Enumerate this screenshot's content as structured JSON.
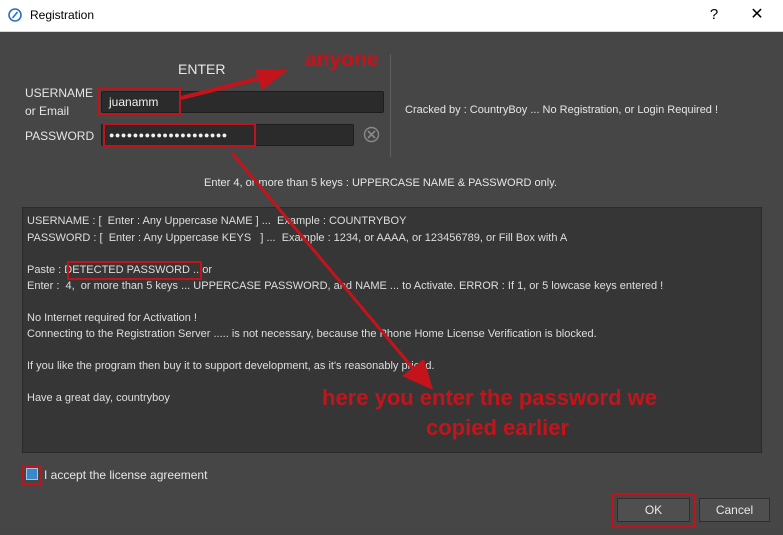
{
  "window": {
    "title": "Registration",
    "help_label": "?",
    "close_label": "✕"
  },
  "form": {
    "heading": "ENTER",
    "username_label_line1": "USERNAME",
    "username_label_line2": "or Email",
    "username_value": "juanamm",
    "password_label": "PASSWORD",
    "password_value": "●●●●●●●●●●●●●●●●●●●●"
  },
  "crack_note": "Cracked by : CountryBoy ... No Registration, or Login Required !",
  "hint": "Enter 4, or more than 5 keys : UPPERCASE NAME & PASSWORD only.",
  "info": {
    "line1": "USERNAME : [  Enter : Any Uppercase NAME ] ...  Example : COUNTRYBOY",
    "line2": "PASSWORD : [  Enter : Any Uppercase KEYS   ] ...  Example : 1234, or AAAA, or 123456789, or Fill Box with A",
    "line3_prefix": "Paste : ",
    "line3_highlight": "DETECTED PASSWORD",
    "line3_suffix": " .. or",
    "line4": "Enter :  4,  or more than 5 keys ... UPPERCASE PASSWORD, and NAME ... to Activate. ERROR : If 1, or 5 lowcase keys entered !",
    "line5": "No Internet required for Activation !",
    "line6": "Connecting to the Registration Server ..... is not necessary, because the Phone Home License Verification is blocked.",
    "line7": "If you like the program then buy it to support development, as it's reasonably priced.",
    "line8": "Have a great day, countryboy"
  },
  "license": {
    "label": "I accept the license agreement",
    "checked": true
  },
  "buttons": {
    "ok": "OK",
    "cancel": "Cancel"
  },
  "annotations": {
    "anyone": "anyone",
    "instruction_line1": "here you enter the password we",
    "instruction_line2": "copied earlier"
  },
  "colors": {
    "annotation_red": "#c3141b",
    "background": "#464646",
    "checkbox_fill": "#3b87c8"
  },
  "icons": {
    "clear_field": "clear-x-icon",
    "app": "app-logo-icon"
  }
}
